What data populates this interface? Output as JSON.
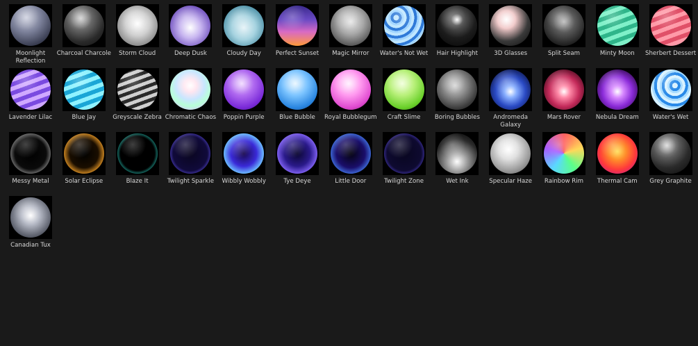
{
  "materials": [
    {
      "label": "Moonlight Reflection",
      "icon": "moonlight-reflection-matcap",
      "bg": "radial-gradient(circle at 40% 30%, #c9ccdc 0%, #7a7f98 40%, #3a3e52 75%, #1a1c28 100%)"
    },
    {
      "label": "Charcoal Charcole",
      "icon": "charcoal-matcap",
      "bg": "radial-gradient(circle at 42% 32%, #cfcfcf 0%, #6a6a6a 30%, #2a2a2a 65%, #0d0d0d 100%)"
    },
    {
      "label": "Storm Cloud",
      "icon": "storm-cloud-matcap",
      "bg": "radial-gradient(circle at 50% 45%, #ffffff 0%, #d0d0d0 40%, #8a8a8a 75%, #3a3a3a 100%)"
    },
    {
      "label": "Deep Dusk",
      "icon": "deep-dusk-matcap",
      "bg": "radial-gradient(circle at 50% 55%, #ffffff 0%, #c8b6f0 35%, #7a5cc4 70%, #3a2470 100%)"
    },
    {
      "label": "Cloudy Day",
      "icon": "cloudy-day-matcap",
      "bg": "radial-gradient(circle at 50% 55%, #e8f4f8 0%, #a6d3e0 40%, #4f92a8 75%, #1c4858 100%)"
    },
    {
      "label": "Perfect Sunset",
      "icon": "perfect-sunset-matcap",
      "bg": "linear-gradient(180deg, #3a2a8c 0%, #6a4ac4 35%, #d86ac4 65%, #ff9a3a 100%)"
    },
    {
      "label": "Magic Mirror",
      "icon": "magic-mirror-matcap",
      "bg": "radial-gradient(circle at 50% 40%, #e8e8e8 0%, #a8a8a8 40%, #5a5a5a 75%, #1e1e1e 100%)"
    },
    {
      "label": "Water's Not Wet",
      "icon": "waters-not-wet-matcap",
      "bg": "repeating-radial-gradient(circle at 30% 30%, #bfe6ff 0 4px, #2f7ad8 4px 8px, #9fd4ff 8px 11px)"
    },
    {
      "label": "Hair Highlight",
      "icon": "hair-highlight-matcap",
      "bg": "radial-gradient(circle at 50% 35%, #ffffff 0%, #5a5a5a 18%, #1c1c1c 55%, #050505 100%)"
    },
    {
      "label": "3D Glasses",
      "icon": "3d-glasses-matcap",
      "bg": "radial-gradient(circle at 40% 35%, #ffffff 0%, #f1c9c9 25%, #3a3a3a 60%, #0a0a0a 100%)"
    },
    {
      "label": "Split Seam",
      "icon": "split-seam-matcap",
      "bg": "radial-gradient(circle at 50% 40%, #bdbdbd 0%, #5a5a5a 35%, #1e1e1e 75%, #060606 100%)"
    },
    {
      "label": "Minty Moon",
      "icon": "minty-moon-matcap",
      "bg": "repeating-linear-gradient(160deg, #7ff0c8 0 6px, #2fb58a 6px 12px)"
    },
    {
      "label": "Sherbert Dessert",
      "icon": "sherbert-dessert-matcap",
      "bg": "repeating-linear-gradient(160deg, #ff9aa8 0 6px, #e05068 6px 12px)"
    },
    {
      "label": "Lavender Lilac",
      "icon": "lavender-lilac-matcap",
      "bg": "repeating-linear-gradient(160deg, #cfa8ff 0 6px, #7a4ae0 6px 12px)"
    },
    {
      "label": "Blue Jay",
      "icon": "blue-jay-matcap",
      "bg": "repeating-linear-gradient(160deg, #8ff2ff 0 6px, #1aa6d6 6px 12px)"
    },
    {
      "label": "Greyscale Zebra",
      "icon": "greyscale-zebra-matcap",
      "bg": "repeating-linear-gradient(160deg, #cfcfcf 0 5px, #2a2a2a 5px 10px)"
    },
    {
      "label": "Chromatic Chaos",
      "icon": "chromatic-chaos-matcap",
      "bg": "radial-gradient(circle at 50% 40%, #ffffff 0%, #ffe6f0 20%, #c8e6ff 45%, #b8ffd8 65%, #d8c8ff 85%, #ffffff 100%)"
    },
    {
      "label": "Poppin Purple",
      "icon": "poppin-purple-matcap",
      "bg": "radial-gradient(circle at 45% 35%, #f0d8ff 0%, #b06af0 35%, #7a2ad8 70%, #3a0e7a 100%)"
    },
    {
      "label": "Blue Bubble",
      "icon": "blue-bubble-matcap",
      "bg": "radial-gradient(circle at 45% 35%, #e8f6ff 0%, #7cc4ff 35%, #2a86e0 70%, #0e3a7a 100%)"
    },
    {
      "label": "Royal Bubblegum",
      "icon": "royal-bubblegum-matcap",
      "bg": "radial-gradient(circle at 45% 35%, #fff0ff 0%, #ff9aef 35%, #e04ad0 70%, #7a1a6a 100%)"
    },
    {
      "label": "Craft Slime",
      "icon": "craft-slime-matcap",
      "bg": "radial-gradient(circle at 45% 35%, #f0ffd8 0%, #b8f07a 35%, #6ad02a 70%, #2a6a0e 100%)"
    },
    {
      "label": "Boring Bubbles",
      "icon": "boring-bubbles-matcap",
      "bg": "radial-gradient(circle at 45% 40%, #d8d8d8 0%, #8a8a8a 35%, #3a3a3a 70%, #0e0e0e 100%)"
    },
    {
      "label": "Andromeda Galaxy",
      "icon": "andromeda-galaxy-matcap",
      "bg": "radial-gradient(circle at 50% 55%, #ffffff 0%, #8ab0ff 20%, #2a4ac4 50%, #0a1240 85%, #000000 100%)"
    },
    {
      "label": "Mars Rover",
      "icon": "mars-rover-matcap",
      "bg": "radial-gradient(circle at 50% 55%, #ffffff 0%, #ff8aa8 20%, #c42a5a 50%, #40081a 85%, #000000 100%)"
    },
    {
      "label": "Nebula Dream",
      "icon": "nebula-dream-matcap",
      "bg": "radial-gradient(circle at 50% 55%, #ffffff 0%, #d88aff 20%, #8a2ad8 50%, #2a0840 85%, #000000 100%)"
    },
    {
      "label": "Water's Wet",
      "icon": "waters-wet-matcap",
      "bg": "repeating-radial-gradient(circle at 60% 40%, #d8f2ff 0 4px, #2a8ae8 4px 8px, #a8dcff 8px 11px)"
    },
    {
      "label": "Messy Metal",
      "icon": "messy-metal-matcap",
      "bg": "radial-gradient(circle at 50% 50%, #000000 0%, #0a0a0a 55%, #9a9a9a 80%, #3a3a3a 100%)"
    },
    {
      "label": "Solar Eclipse",
      "icon": "solar-eclipse-matcap",
      "bg": "radial-gradient(circle at 50% 50%, #000000 0%, #1a0e00 50%, #ffa82a 78%, #7a3a00 100%)"
    },
    {
      "label": "Blaze It",
      "icon": "blaze-it-matcap",
      "bg": "radial-gradient(circle at 50% 50%, #000000 0%, #000000 60%, #2ad8c8 82%, #0a3a3a 100%)"
    },
    {
      "label": "Twilight Sparkle",
      "icon": "twilight-sparkle-matcap",
      "bg": "radial-gradient(circle at 50% 50%, #0a0620 0%, #100a3a 60%, #6a5aff 85%, #1a1050 100%)"
    },
    {
      "label": "Wibbly Wobbly",
      "icon": "wibbly-wobbly-matcap",
      "bg": "radial-gradient(circle at 50% 50%, #1a0a50 0%, #3a2ad8 45%, #6ab8ff 70%, #2a1aa8 100%)"
    },
    {
      "label": "Tye Deye",
      "icon": "tye-deye-matcap",
      "bg": "radial-gradient(circle at 50% 50%, #0a0630 0%, #2a1a8a 45%, #8a6aff 75%, #3a2ac4 100%)"
    },
    {
      "label": "Little Door",
      "icon": "little-door-matcap",
      "bg": "radial-gradient(circle at 50% 50%, #050310 0%, #1a0e6a 50%, #4a8aff 80%, #2a2ab8 100%)"
    },
    {
      "label": "Twilight Zone",
      "icon": "twilight-zone-matcap",
      "bg": "radial-gradient(circle at 50% 50%, #080620 0%, #0e0a30 60%, #5a4ae0 85%, #1a1250 100%)"
    },
    {
      "label": "Wet Ink",
      "icon": "wet-ink-matcap",
      "bg": "radial-gradient(circle at 50% 70%, #ffffff 0%, #9a9a9a 30%, #2a2a2a 65%, #000000 100%)"
    },
    {
      "label": "Specular Haze",
      "icon": "specular-haze-matcap",
      "bg": "radial-gradient(circle at 45% 40%, #ffffff 0%, #e0e0e0 30%, #9a9a9a 65%, #4a4a4a 100%)"
    },
    {
      "label": "Rainbow Rim",
      "icon": "rainbow-rim-matcap",
      "bg": "conic-gradient(from 0deg, #ff5a5a, #ffd85a, #5aff8a, #5ad8ff, #a85aff, #ff5a5a)"
    },
    {
      "label": "Thermal Cam",
      "icon": "thermal-cam-matcap",
      "bg": "radial-gradient(circle at 50% 45%, #ffe05a 0%, #ff8a2a 30%, #ff3a3a 60%, #c41a8a 90%, #6a0a6a 100%)"
    },
    {
      "label": "Grey Graphite",
      "icon": "grey-graphite-matcap",
      "bg": "radial-gradient(circle at 40% 30%, #d8d8d8 0%, #6a6a6a 25%, #2a2a2a 60%, #0a0a0a 100%)"
    },
    {
      "label": "Canadian Tux",
      "icon": "canadian-tux-matcap",
      "bg": "radial-gradient(circle at 50% 45%, #ffffff 0%, #b8bcc8 30%, #5a5e6a 70%, #1a1c22 100%)"
    }
  ]
}
